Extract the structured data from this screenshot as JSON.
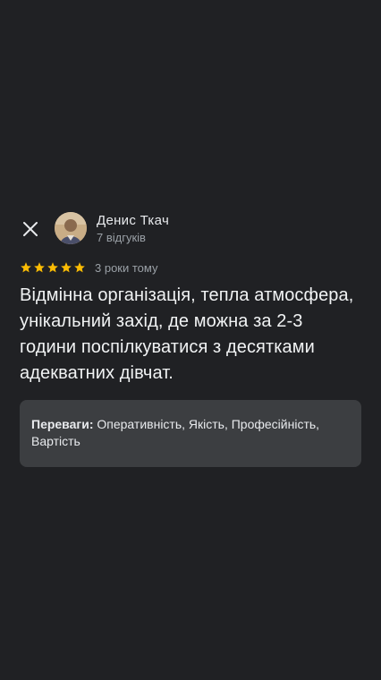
{
  "header": {
    "close_icon": "close-icon",
    "author_name": "Денис Ткач",
    "author_reviews": "7 відгуків"
  },
  "rating": {
    "stars": 5,
    "max_stars": 5,
    "star_color": "#fbbc04",
    "time_ago": "3 роки тому"
  },
  "review": {
    "text": "Відмінна організація, тепла атмосфера, унікальний захід, де можна за 2-3 години поспілкуватися з десятками адекватних дівчат."
  },
  "pros": {
    "label": "Переваги:",
    "value": " Оперативність, Якість, Професійність, Вартість"
  },
  "colors": {
    "background": "#202124",
    "card": "#3c3e41",
    "text_primary": "#e8eaed",
    "text_secondary": "#9aa0a6",
    "star": "#fbbc04"
  }
}
